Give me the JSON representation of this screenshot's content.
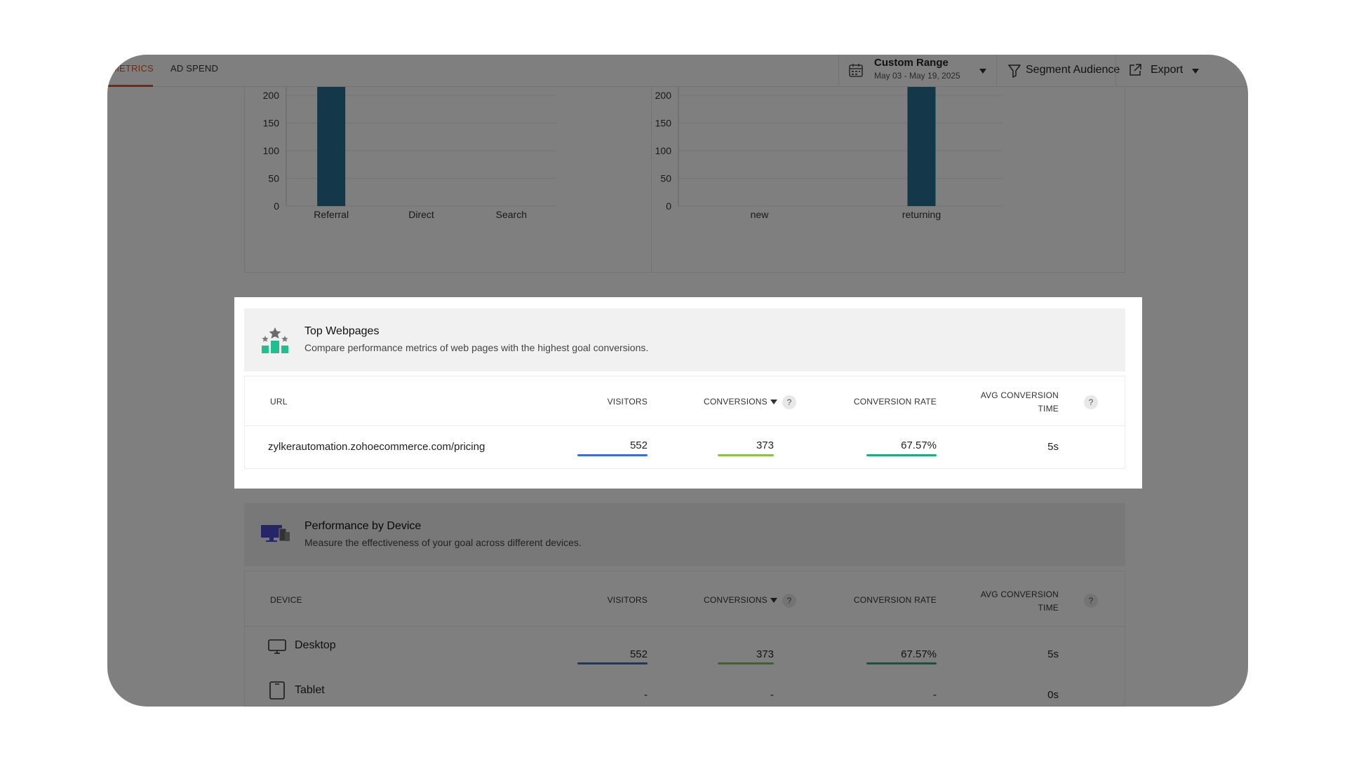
{
  "tabs": [
    {
      "label": "METRICS",
      "active": true
    },
    {
      "label": "AD SPEND",
      "active": false
    }
  ],
  "toolbar": {
    "range_title": "Custom Range",
    "range_dates": "May 03 - May 19, 2025",
    "segment_label": "Segment Audience",
    "export_label": "Export"
  },
  "chart_data": [
    {
      "type": "bar",
      "categories": [
        "Referral",
        "Direct",
        "Search"
      ],
      "values": [
        215,
        0,
        0
      ],
      "ylim": [
        0,
        215
      ],
      "yticks": [
        0,
        50,
        100,
        150,
        200
      ],
      "color": "#2a6f94",
      "grid": true
    },
    {
      "type": "bar",
      "categories": [
        "new",
        "returning"
      ],
      "values": [
        0,
        215
      ],
      "ylim": [
        0,
        215
      ],
      "yticks": [
        0,
        50,
        100,
        150,
        200
      ],
      "color": "#2a6f94",
      "grid": true
    }
  ],
  "top_webpages": {
    "title": "Top Webpages",
    "description": "Compare performance metrics of web pages with the highest goal conversions.",
    "headers": {
      "url": "URL",
      "visitors": "VISITORS",
      "conversions": "CONVERSIONS",
      "conversion_rate": "CONVERSION RATE",
      "avg_time_line1": "AVG CONVERSION",
      "avg_time_line2": "TIME"
    },
    "help_symbol": "?",
    "rows": [
      {
        "url": "zylkerautomation.zohoecommerce.com/pricing",
        "visitors": "552",
        "conversions": "373",
        "conversion_rate": "67.57%",
        "avg_time": "5s"
      }
    ]
  },
  "device_performance": {
    "title": "Performance by Device",
    "description": "Measure the effectiveness of your goal across different devices.",
    "headers": {
      "device": "DEVICE",
      "visitors": "VISITORS",
      "conversions": "CONVERSIONS",
      "conversion_rate": "CONVERSION RATE",
      "avg_time_line1": "AVG CONVERSION",
      "avg_time_line2": "TIME"
    },
    "help_symbol": "?",
    "rows": [
      {
        "device": "Desktop",
        "icon": "desktop-icon",
        "visitors": "552",
        "conversions": "373",
        "conversion_rate": "67.57%",
        "avg_time": "5s"
      },
      {
        "device": "Tablet",
        "icon": "tablet-icon",
        "visitors": "-",
        "conversions": "-",
        "conversion_rate": "-",
        "avg_time": "0s"
      }
    ]
  },
  "colors": {
    "accent": "#e8541c",
    "bar": "#2a6f94",
    "visitors_bar": "#3b6fd4",
    "conversions_bar": "#8bc34a",
    "rate_bar": "#1fae7a"
  }
}
